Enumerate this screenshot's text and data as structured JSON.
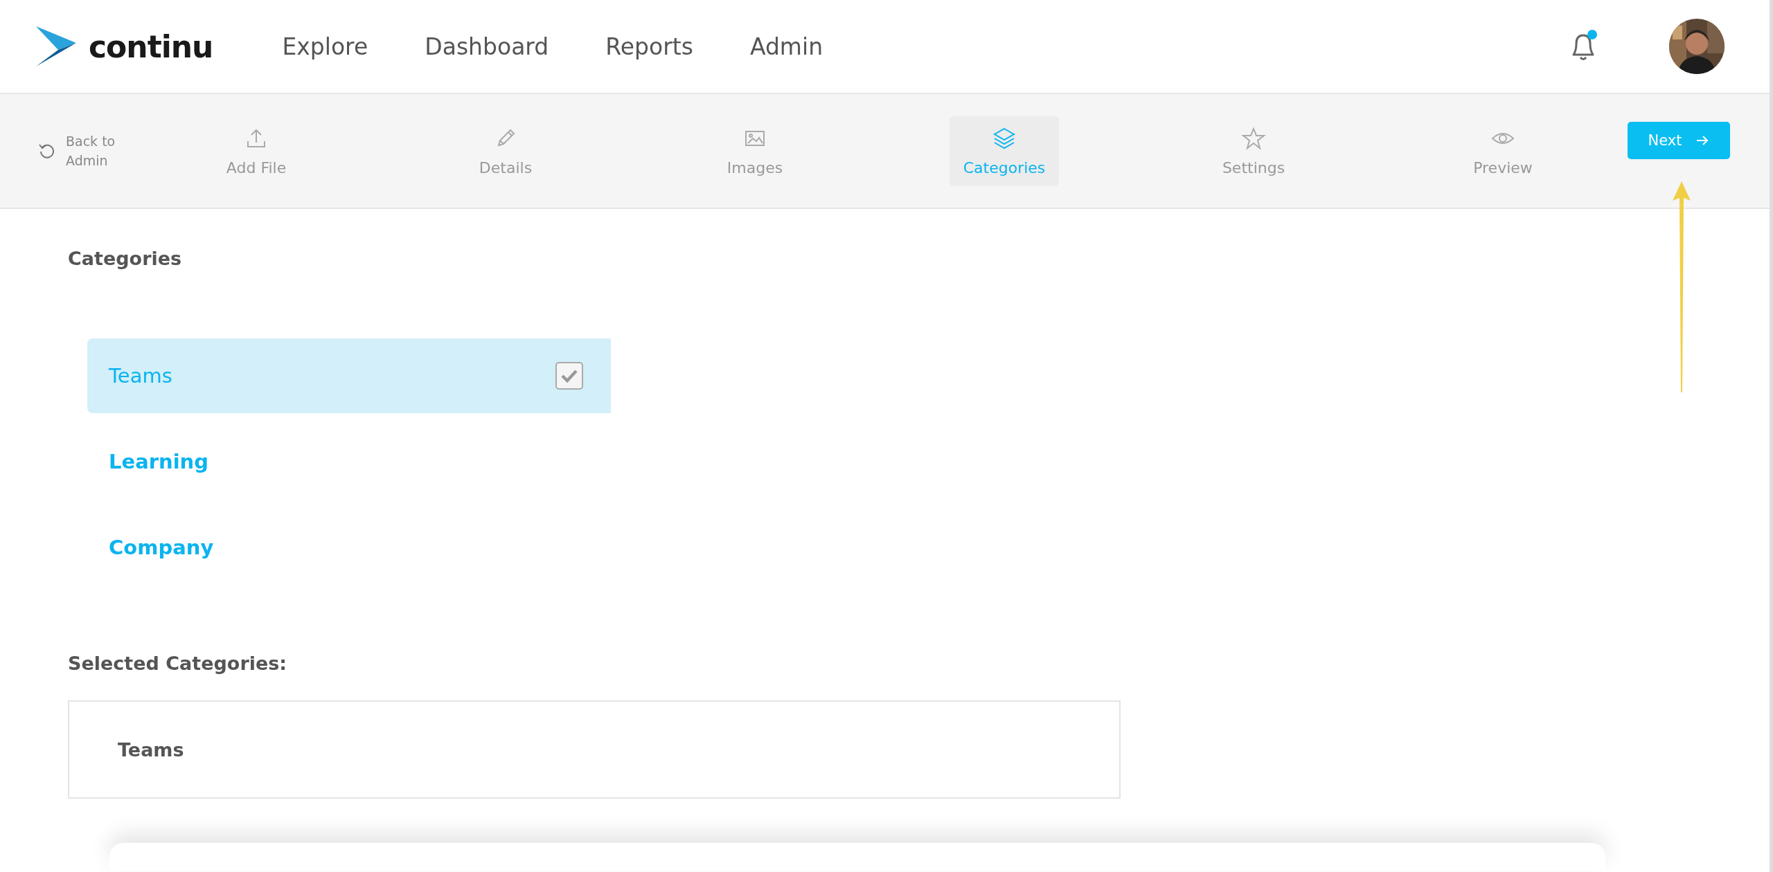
{
  "header": {
    "logo": "continu",
    "nav": [
      {
        "label": "Explore"
      },
      {
        "label": "Dashboard"
      },
      {
        "label": "Reports"
      },
      {
        "label": "Admin"
      }
    ],
    "notifications": {
      "unread": true
    }
  },
  "toolbar": {
    "back_link": {
      "label": "Back to Admin"
    },
    "steps": [
      {
        "label": "Add File",
        "selected": false
      },
      {
        "label": "Details",
        "selected": false
      },
      {
        "label": "Images",
        "selected": false
      },
      {
        "label": "Categories",
        "selected": true
      },
      {
        "label": "Settings",
        "selected": false
      },
      {
        "label": "Preview",
        "selected": false
      }
    ],
    "next_button": {
      "label": "Next"
    }
  },
  "categories": {
    "title": "Categories",
    "items": [
      {
        "label": "Teams",
        "selected": true,
        "checked": true
      },
      {
        "label": "Learning",
        "selected": false,
        "checked": false
      },
      {
        "label": "Company",
        "selected": false,
        "checked": false
      }
    ]
  },
  "selected_categories": {
    "title": "Selected Categories:",
    "items": [
      "Teams"
    ]
  },
  "annotation": {
    "kind": "arrow"
  }
}
